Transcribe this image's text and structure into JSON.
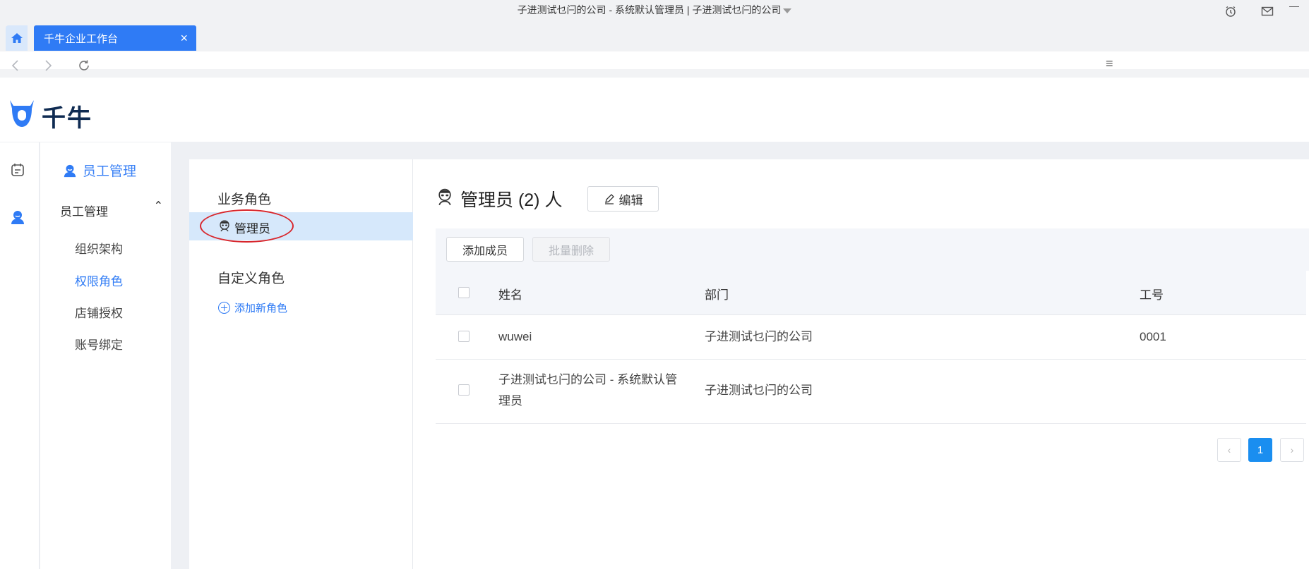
{
  "window": {
    "title": "子进测试乜闩的公司 - 系统默认管理员 | 子进测试乜闩的公司",
    "minimize": "—"
  },
  "tabs": {
    "active_label": "千牛企业工作台",
    "close": "×"
  },
  "navbar": {
    "menu": "≡"
  },
  "brand": {
    "name": "千牛",
    "accent": "#2f7bf5"
  },
  "sidebar": {
    "title": "员工管理",
    "group": "员工管理",
    "group_chevron": "⌃",
    "items": [
      {
        "label": "组织架构"
      },
      {
        "label": "权限角色"
      },
      {
        "label": "店铺授权"
      },
      {
        "label": "账号绑定"
      }
    ]
  },
  "roles": {
    "business_heading": "业务角色",
    "selected_role": "管理员",
    "custom_heading": "自定义角色",
    "add_role": "添加新角色"
  },
  "detail": {
    "title": "管理员 (2) 人",
    "edit": "编辑",
    "add_member": "添加成员",
    "batch_delete": "批量删除"
  },
  "table": {
    "columns": [
      "姓名",
      "部门",
      "工号"
    ],
    "rows": [
      {
        "name": "wuwei",
        "dept": "子进测试乜闩的公司",
        "id": "0001"
      },
      {
        "name": "子进测试乜闩的公司 - 系统默认管理员",
        "dept": "子进测试乜闩的公司",
        "id": ""
      }
    ]
  },
  "pagination": {
    "prev": "‹",
    "current": "1",
    "next": "›"
  }
}
